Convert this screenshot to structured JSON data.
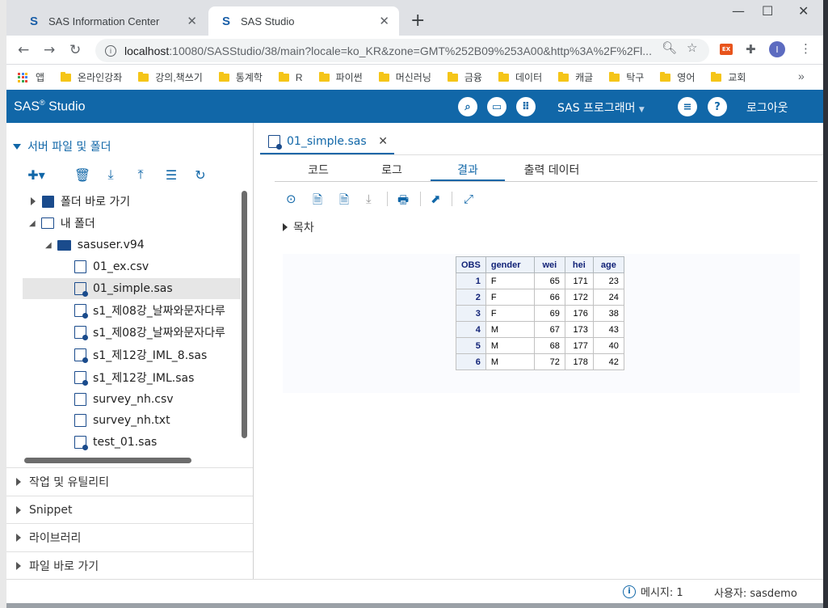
{
  "browser": {
    "tabs": [
      {
        "title": "SAS Information Center"
      },
      {
        "title": "SAS Studio"
      }
    ],
    "url_host": "localhost",
    "url_path": ":10080/SASStudio/38/main?locale=ko_KR&zone=GMT%252B09%253A00&http%3A%2F%2Fl...",
    "profile_initial": "I",
    "bookmarks": [
      "앱",
      "온라인강좌",
      "강의,책쓰기",
      "통계학",
      "R",
      "파이썬",
      "머신러닝",
      "금융",
      "데이터",
      "캐글",
      "탁구",
      "영어",
      "교회"
    ]
  },
  "sas": {
    "title": "SAS",
    "title_suffix": "Studio",
    "mode_label": "SAS 프로그래머",
    "logout_label": "로그아웃",
    "accent": "#1167a8"
  },
  "left": {
    "section_title": "서버 파일 및 폴더",
    "tree": [
      {
        "label": "폴더 바로 가기",
        "kind": "shortcut"
      },
      {
        "label": "내 폴더",
        "kind": "myfolder"
      },
      {
        "label": "sasuser.v94",
        "kind": "folder"
      },
      {
        "label": "01_ex.csv",
        "kind": "csv"
      },
      {
        "label": "01_simple.sas",
        "kind": "sas",
        "selected": true
      },
      {
        "label": "s1_제08강_날짜와문자다루",
        "kind": "sas"
      },
      {
        "label": "s1_제08강_날짜와문자다루",
        "kind": "sas"
      },
      {
        "label": "s1_제12강_IML_8.sas",
        "kind": "sas"
      },
      {
        "label": "s1_제12강_IML.sas",
        "kind": "sas"
      },
      {
        "label": "survey_nh.csv",
        "kind": "csv"
      },
      {
        "label": "survey_nh.txt",
        "kind": "txt"
      },
      {
        "label": "test_01.sas",
        "kind": "sas"
      }
    ],
    "accordions": [
      "작업 및 유틸리티",
      "Snippet",
      "라이브러리",
      "파일 바로 가기"
    ]
  },
  "editor": {
    "file_tab": "01_simple.sas",
    "subtabs": [
      "코드",
      "로그",
      "결과",
      "출력 데이터"
    ],
    "active_subtab": "결과",
    "toc_label": "목차",
    "table": {
      "headers": [
        "OBS",
        "gender",
        "wei",
        "hei",
        "age"
      ],
      "rows": [
        [
          "1",
          "F",
          "65",
          "171",
          "23"
        ],
        [
          "2",
          "F",
          "66",
          "172",
          "24"
        ],
        [
          "3",
          "F",
          "69",
          "176",
          "38"
        ],
        [
          "4",
          "M",
          "67",
          "173",
          "43"
        ],
        [
          "5",
          "M",
          "68",
          "177",
          "40"
        ],
        [
          "6",
          "M",
          "72",
          "178",
          "42"
        ]
      ]
    }
  },
  "status": {
    "message_label": "메시지: 1",
    "user_label": "사용자: sasdemo"
  }
}
